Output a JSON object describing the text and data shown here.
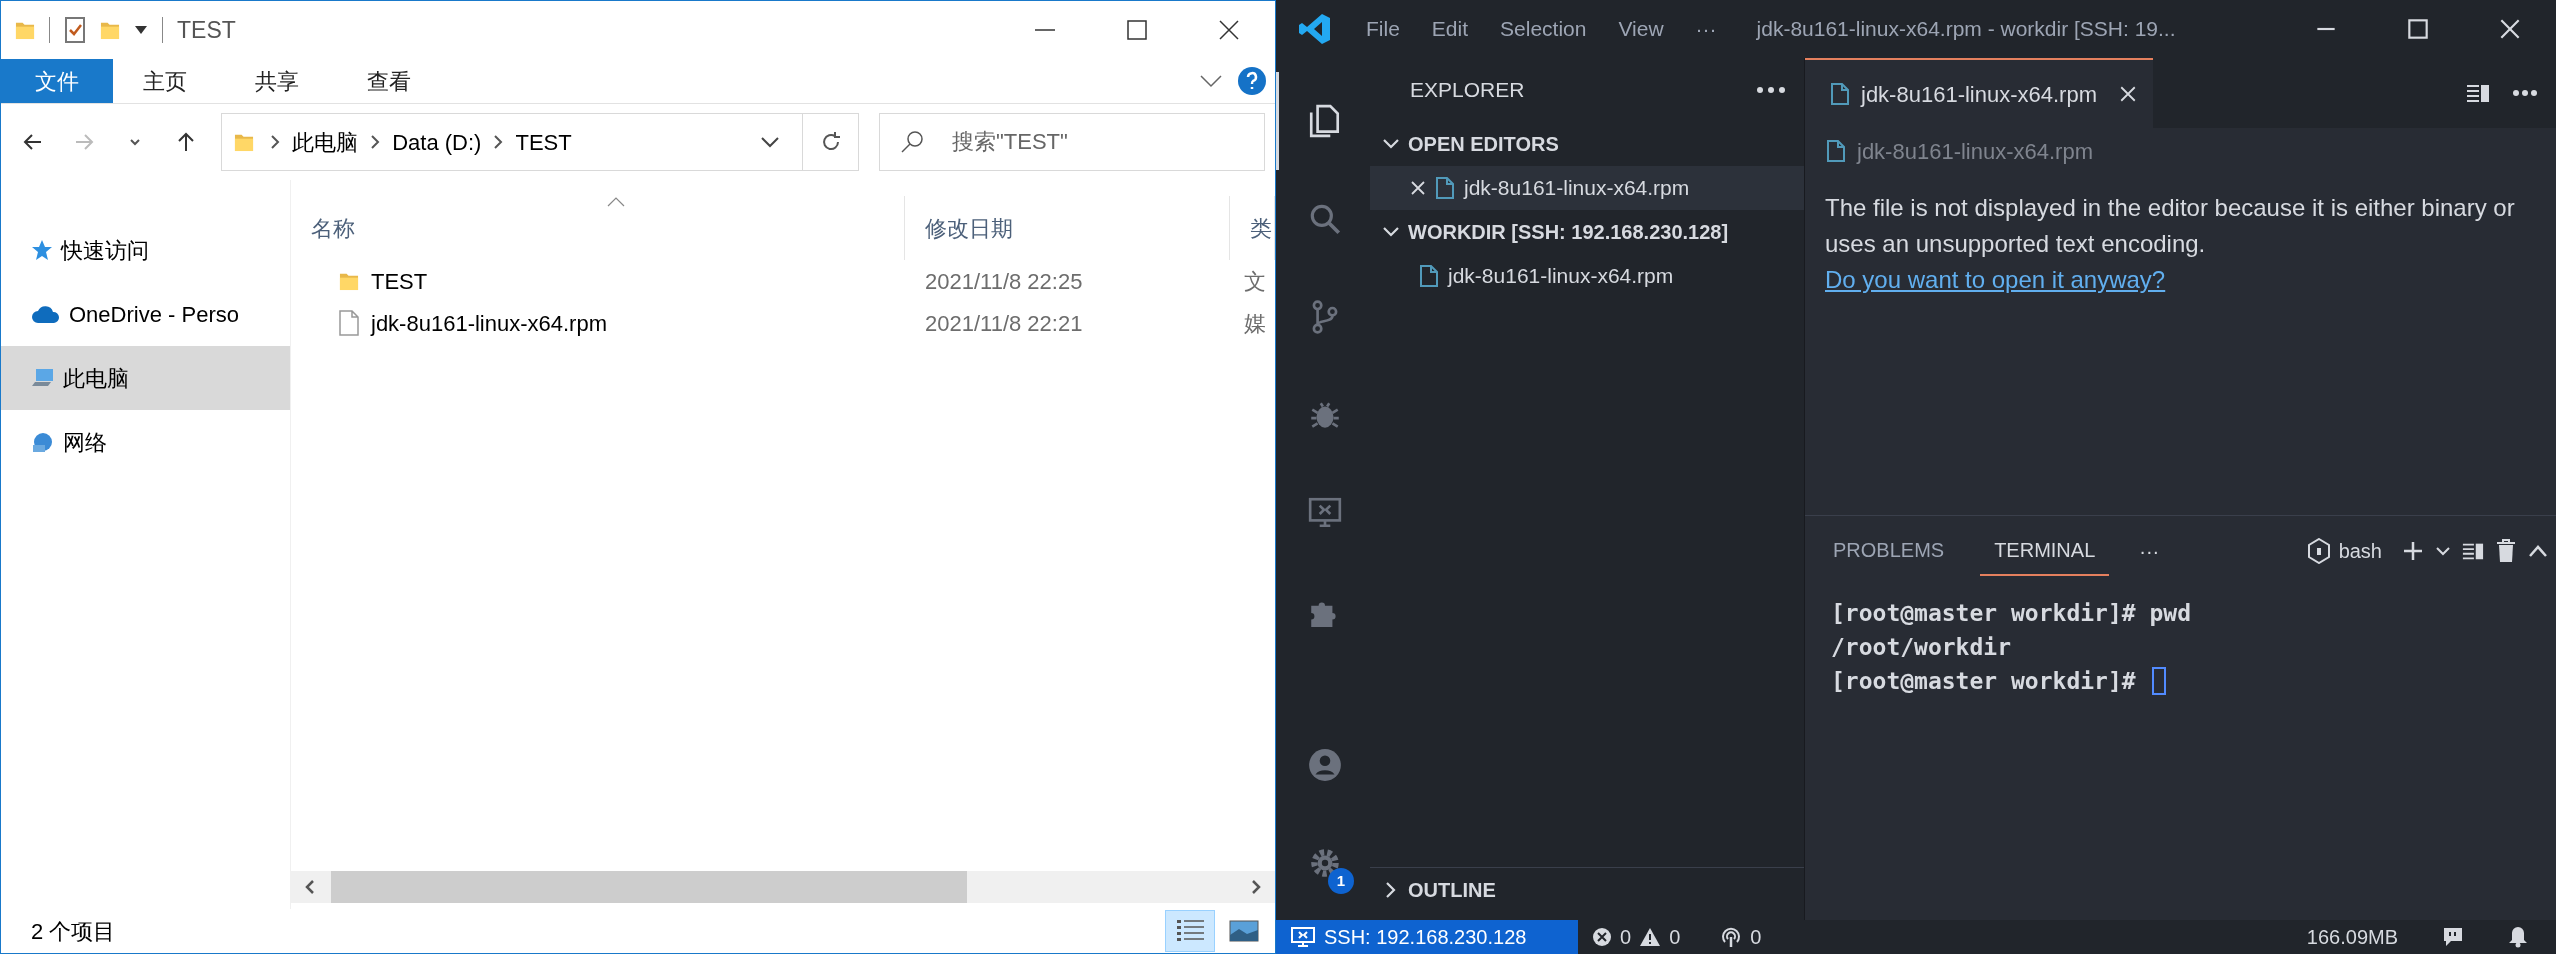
{
  "explorer": {
    "title": "TEST",
    "ribbon_tabs": [
      {
        "kind": "file",
        "label": "文件"
      },
      {
        "kind": "tab",
        "label": "主页"
      },
      {
        "kind": "tab",
        "label": "共享"
      },
      {
        "kind": "tab",
        "label": "查看"
      }
    ],
    "address": {
      "path": [
        "此电脑",
        "Data (D:)",
        "TEST"
      ]
    },
    "search": {
      "placeholder": "搜索\"TEST\""
    },
    "nav": [
      {
        "kind": "quick",
        "label": "快速访问",
        "selected": false
      },
      {
        "kind": "cloud",
        "label": "OneDrive - Perso",
        "selected": false
      },
      {
        "kind": "pc",
        "label": "此电脑",
        "selected": true
      },
      {
        "kind": "network",
        "label": "网络",
        "selected": false
      }
    ],
    "columns": [
      "名称",
      "修改日期",
      "类"
    ],
    "rows": [
      {
        "kind": "folder",
        "name": "TEST",
        "date": "2021/11/8 22:25",
        "type": "文",
        "selected": false
      },
      {
        "kind": "file",
        "name": "jdk-8u161-linux-x64.rpm",
        "date": "2021/11/8 22:21",
        "type": "媒",
        "selected": false
      }
    ],
    "status": "2 个项目",
    "views": [
      {
        "kind": "details",
        "selected": true
      },
      {
        "kind": "large",
        "selected": false
      }
    ]
  },
  "vscode": {
    "menu": [
      "File",
      "Edit",
      "Selection",
      "View",
      "···"
    ],
    "title": "jdk-8u161-linux-x64.rpm - workdir [SSH: 19...",
    "activity": [
      {
        "kind": "files",
        "selected": true
      },
      {
        "kind": "search",
        "selected": false
      },
      {
        "kind": "scm",
        "selected": false
      },
      {
        "kind": "debug",
        "selected": false
      },
      {
        "kind": "remote",
        "selected": false
      },
      {
        "kind": "extensions",
        "selected": false
      }
    ],
    "activity_bottom": [
      {
        "kind": "account"
      },
      {
        "kind": "settings",
        "badge": "1"
      }
    ],
    "sidebar": {
      "title": "EXPLORER",
      "sections": [
        {
          "title": "OPEN EDITORS",
          "expanded": true,
          "items": [
            {
              "name": "jdk-8u161-linux-x64.rpm",
              "selected": true
            }
          ]
        },
        {
          "title": "WORKDIR [SSH: 192.168.230.128]",
          "expanded": true,
          "items": [
            {
              "name": "jdk-8u161-linux-x64.rpm",
              "selected": false
            }
          ]
        }
      ],
      "outline": {
        "title": "OUTLINE",
        "expanded": false
      }
    },
    "editor": {
      "tabs": [
        {
          "label": "jdk-8u161-linux-x64.rpm",
          "selected": true
        }
      ],
      "breadcrumb": "jdk-8u161-linux-x64.rpm",
      "message": "The file is not displayed in the editor because it is either binary or uses an unsupported text encoding.",
      "link": "Do you want to open it anyway?"
    },
    "panel": {
      "tabs": [
        {
          "label": "PROBLEMS",
          "selected": false
        },
        {
          "label": "TERMINAL",
          "selected": true
        }
      ],
      "more": "···",
      "terminal_name": "bash",
      "lines": [
        "[root@master workdir]# pwd",
        "/root/workdir",
        "[root@master workdir]#"
      ]
    },
    "status_bar": {
      "remote": "SSH: 192.168.230.128",
      "errors": "0",
      "warnings": "0",
      "ports": "0",
      "memory": "166.09MB"
    }
  }
}
